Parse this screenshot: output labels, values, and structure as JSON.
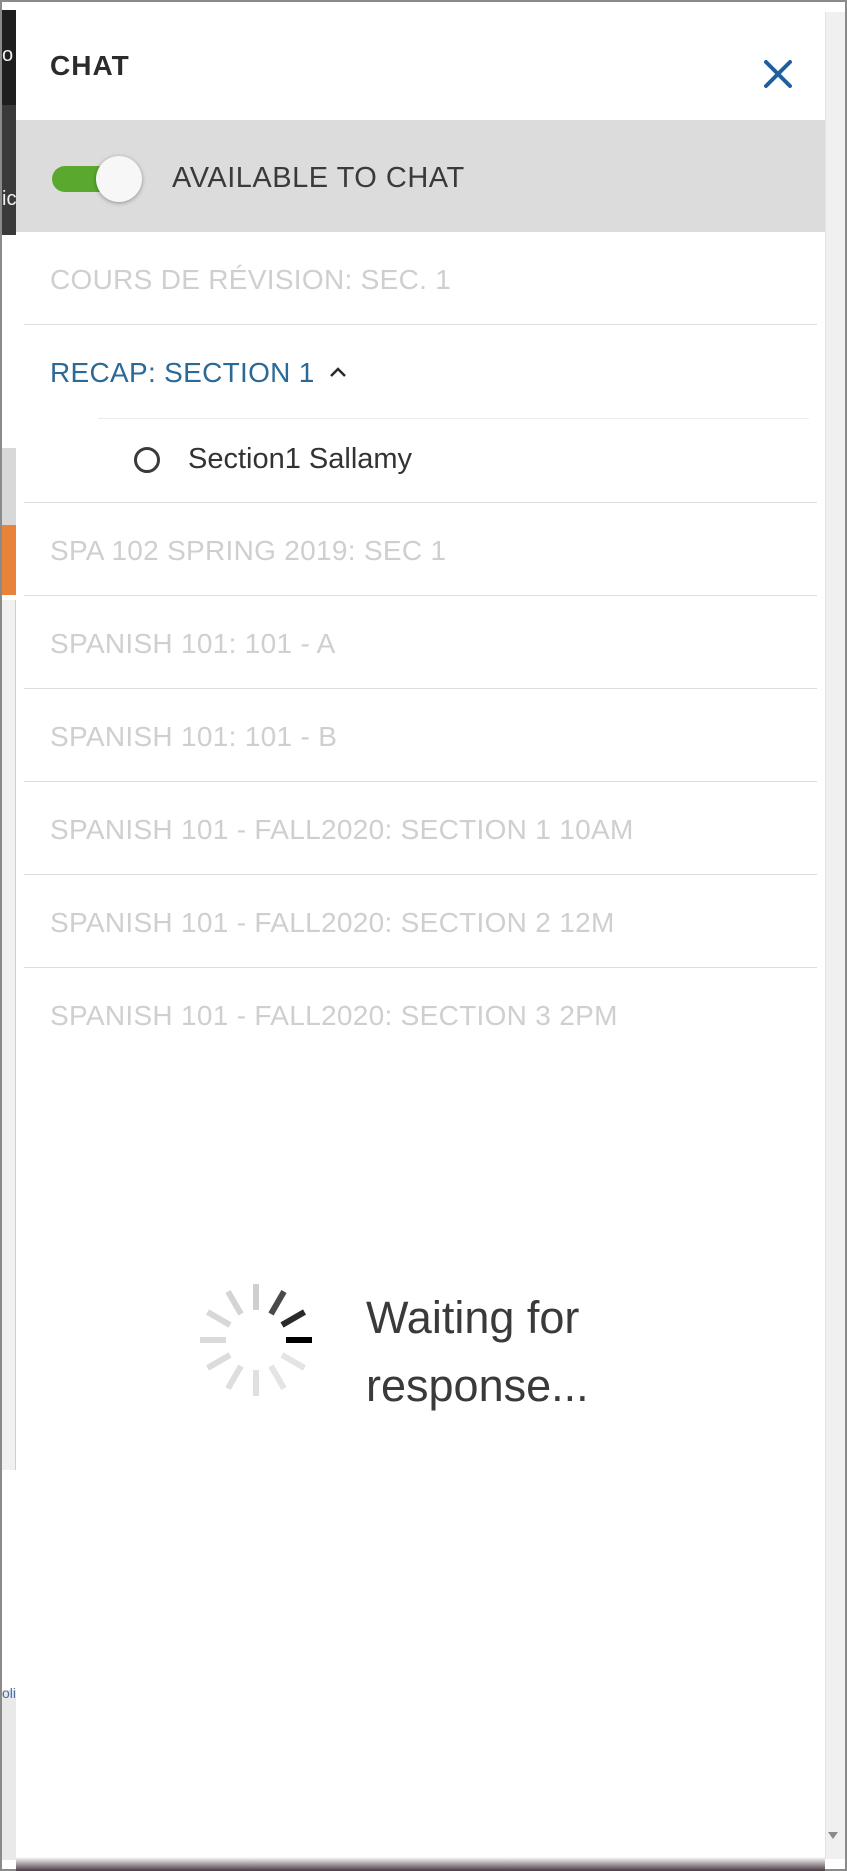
{
  "panel": {
    "title": "CHAT",
    "close_icon": "close-icon"
  },
  "availability": {
    "label": "AVAILABLE TO CHAT",
    "enabled": true,
    "toggle_color": "#5aa92e"
  },
  "courses": [
    {
      "label": "COURS DE RÉVISION: SEC. 1",
      "expanded": false
    },
    {
      "label": "RECAP: SECTION 1",
      "expanded": true,
      "members": [
        {
          "name": "Section1 Sallamy",
          "status_icon": "offline-status-icon"
        }
      ]
    },
    {
      "label": "SPA 102 SPRING 2019: SEC 1",
      "expanded": false
    },
    {
      "label": "SPANISH 101: 101 - A",
      "expanded": false
    },
    {
      "label": "SPANISH 101: 101 - B",
      "expanded": false
    },
    {
      "label": "SPANISH 101 - FALL2020: SECTION 1 10AM",
      "expanded": false
    },
    {
      "label": "SPANISH 101 - FALL2020: SECTION 2 12M",
      "expanded": false
    },
    {
      "label": "SPANISH 101 - FALL2020: SECTION 3 2PM",
      "expanded": false
    }
  ],
  "loading": {
    "line1": "Waiting for",
    "line2": "response...",
    "spinner_icon": "loading-spinner-icon"
  },
  "background": {
    "fragment_top": "o",
    "fragment_mid": "ic",
    "fragment_bottom": "oli"
  },
  "colors": {
    "accent": "#2b6a96",
    "close": "#1f5f9e",
    "muted_course": "#cfcfcf",
    "highlight_row": "#dcdcdc"
  }
}
